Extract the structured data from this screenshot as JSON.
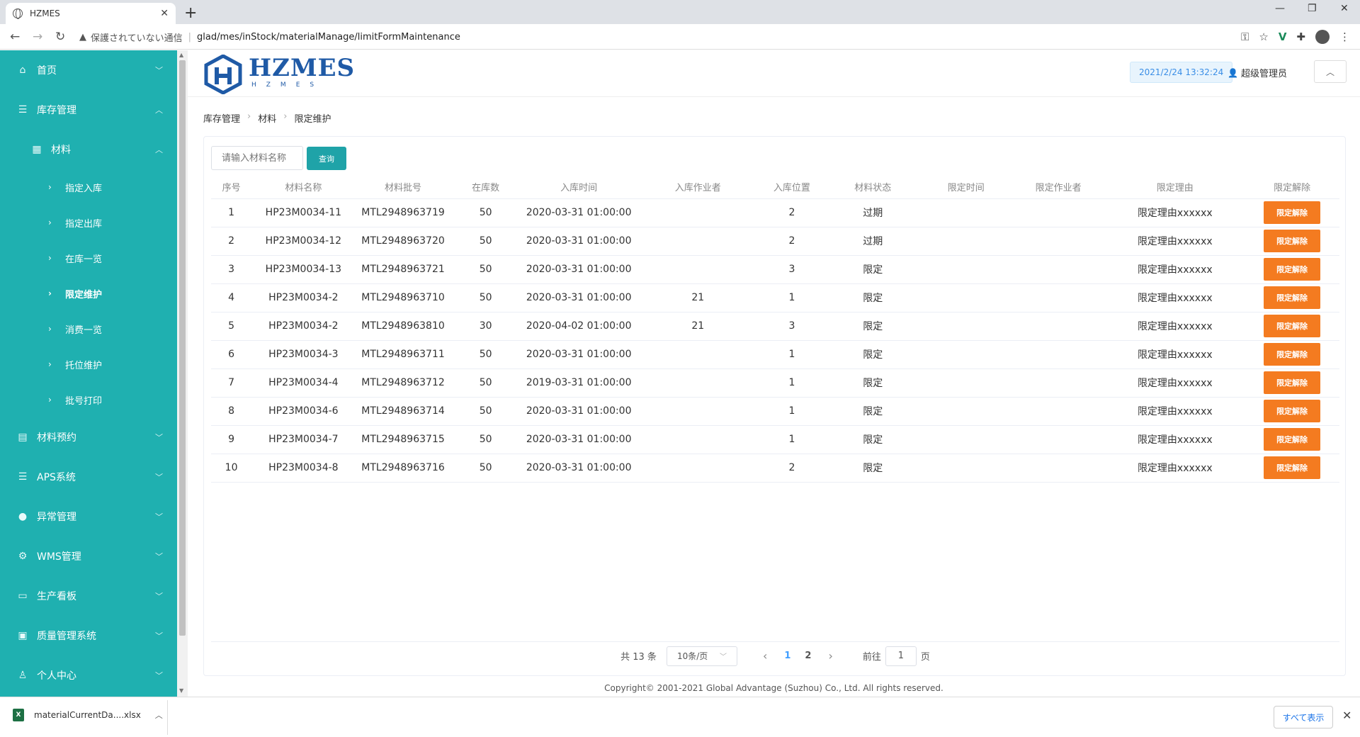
{
  "browser": {
    "tab_title": "HZMES",
    "security_label": "保護されていない通信",
    "url": "glad/mes/inStock/materialManage/limitFormMaintenance"
  },
  "sidebar": {
    "menu_top": [
      {
        "label": "首页",
        "icon": "home-icon"
      },
      {
        "label": "库存管理",
        "icon": "database-icon"
      },
      {
        "label": "材料",
        "icon": "grid-icon"
      }
    ],
    "sub_items": [
      {
        "label": "指定入库"
      },
      {
        "label": "指定出库"
      },
      {
        "label": "在库一览"
      },
      {
        "label": "限定维护"
      },
      {
        "label": "消费一览"
      },
      {
        "label": "托位维护"
      },
      {
        "label": "批号打印"
      }
    ],
    "menu_bottom": [
      {
        "label": "材料预约",
        "icon": "clipboard-icon"
      },
      {
        "label": "APS系统",
        "icon": "sliders-icon"
      },
      {
        "label": "异常管理",
        "icon": "alert-icon"
      },
      {
        "label": "WMS管理",
        "icon": "gear-icon"
      },
      {
        "label": "生产看板",
        "icon": "monitor-icon"
      },
      {
        "label": "质量管理系统",
        "icon": "chart-icon"
      },
      {
        "label": "个人中心",
        "icon": "user-icon"
      }
    ]
  },
  "header": {
    "logo_main": "HZMES",
    "logo_sub": "HZMES",
    "datetime": "2021/2/24 13:32:24",
    "user": "超级管理员"
  },
  "breadcrumb": [
    "库存管理",
    "材料",
    "限定维护"
  ],
  "search": {
    "placeholder": "请输入材料名称",
    "button": "查询"
  },
  "table": {
    "headers": [
      "序号",
      "材料名称",
      "材料批号",
      "在库数",
      "入库时间",
      "入库作业者",
      "入库位置",
      "材料状态",
      "限定时间",
      "限定作业者",
      "限定理由",
      "限定解除"
    ],
    "action_label": "限定解除",
    "rows": [
      [
        "1",
        "HP23M0034-11",
        "MTL2948963719",
        "50",
        "2020-03-31 01:00:00",
        "",
        "2",
        "过期",
        "",
        "",
        "限定理由xxxxxx"
      ],
      [
        "2",
        "HP23M0034-12",
        "MTL2948963720",
        "50",
        "2020-03-31 01:00:00",
        "",
        "2",
        "过期",
        "",
        "",
        "限定理由xxxxxx"
      ],
      [
        "3",
        "HP23M0034-13",
        "MTL2948963721",
        "50",
        "2020-03-31 01:00:00",
        "",
        "3",
        "限定",
        "",
        "",
        "限定理由xxxxxx"
      ],
      [
        "4",
        "HP23M0034-2",
        "MTL2948963710",
        "50",
        "2020-03-31 01:00:00",
        "21",
        "1",
        "限定",
        "",
        "",
        "限定理由xxxxxx"
      ],
      [
        "5",
        "HP23M0034-2",
        "MTL2948963810",
        "30",
        "2020-04-02 01:00:00",
        "21",
        "3",
        "限定",
        "",
        "",
        "限定理由xxxxxx"
      ],
      [
        "6",
        "HP23M0034-3",
        "MTL2948963711",
        "50",
        "2020-03-31 01:00:00",
        "",
        "1",
        "限定",
        "",
        "",
        "限定理由xxxxxx"
      ],
      [
        "7",
        "HP23M0034-4",
        "MTL2948963712",
        "50",
        "2019-03-31 01:00:00",
        "",
        "1",
        "限定",
        "",
        "",
        "限定理由xxxxxx"
      ],
      [
        "8",
        "HP23M0034-6",
        "MTL2948963714",
        "50",
        "2020-03-31 01:00:00",
        "",
        "1",
        "限定",
        "",
        "",
        "限定理由xxxxxx"
      ],
      [
        "9",
        "HP23M0034-7",
        "MTL2948963715",
        "50",
        "2020-03-31 01:00:00",
        "",
        "1",
        "限定",
        "",
        "",
        "限定理由xxxxxx"
      ],
      [
        "10",
        "HP23M0034-8",
        "MTL2948963716",
        "50",
        "2020-03-31 01:00:00",
        "",
        "2",
        "限定",
        "",
        "",
        "限定理由xxxxxx"
      ]
    ]
  },
  "pager": {
    "total": "共 13 条",
    "page_size": "10条/页",
    "pages": [
      "1",
      "2"
    ],
    "goto_prefix": "前往",
    "goto_value": "1",
    "goto_suffix": "页"
  },
  "footer": "Copyright© 2001-2021 Global Advantage (Suzhou) Co., Ltd. All rights reserved.",
  "download": {
    "filename": "materialCurrentDa....xlsx",
    "show_all": "すべて表示"
  },
  "colors": {
    "sidebar": "#1fb0b0",
    "accent": "#1fa3a8",
    "release_button": "#f47b20",
    "link": "#409eff"
  }
}
